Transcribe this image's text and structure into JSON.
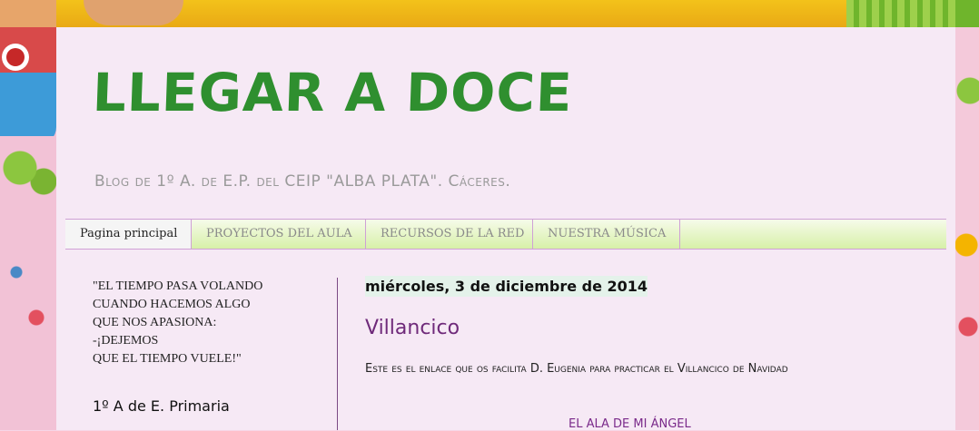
{
  "header": {
    "title": "LLEGAR A DOCE",
    "description": "Blog de 1º A. de E.P. del CEIP \"ALBA PLATA\". Cáceres."
  },
  "nav": {
    "tabs": [
      {
        "label": "Pagina principal"
      },
      {
        "label": "PROYECTOS DEL AULA"
      },
      {
        "label": "RECURSOS DE LA RED"
      },
      {
        "label": "NUESTRA MÚSICA"
      }
    ]
  },
  "sidebar": {
    "quote_lines": [
      "\"EL TIEMPO PASA VOLANDO",
      "CUANDO HACEMOS ALGO",
      "QUE NOS APASIONA:",
      "-¡DEJEMOS",
      "QUE EL TIEMPO VUELE!\""
    ],
    "heading": "1º A de E. Primaria"
  },
  "post": {
    "date": "miércoles, 3 de diciembre de 2014",
    "title": "Villancico",
    "body": "Este es el enlace que os facilita D. Eugenia para practicar el Villancico de Navidad",
    "link": "EL ALA DE MI ÁNGEL"
  },
  "colors": {
    "title_green": "#2f8f2f",
    "panel_bg": "#f6e9f5",
    "post_title_purple": "#6f2a7a",
    "tab_border": "#cfa0d6"
  }
}
